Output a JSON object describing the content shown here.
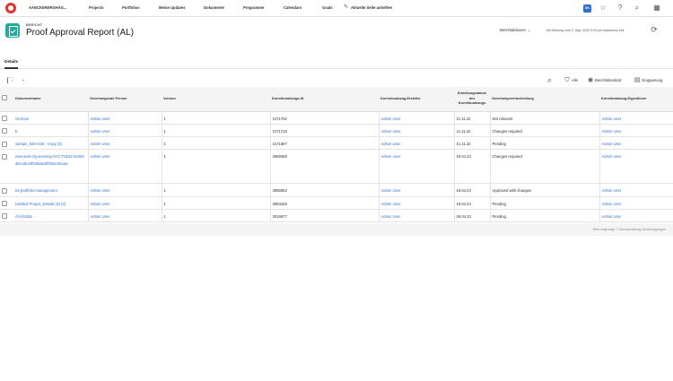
{
  "nav": {
    "org": "AANCKERERSHÄG...",
    "items": [
      "Projects",
      "Portfolios",
      "Meine Updates",
      "Dokumente",
      "Programme",
      "Calendars",
      "Goals"
    ],
    "pin_label": "Aktuelle Seite anheften",
    "avatar_initials": "SK"
  },
  "header": {
    "kind": "BERICHT",
    "title": "Proof Approval Report (AL)",
    "actions_label": "Berichtaktionen",
    "last_updated": "Mit Wirkung vom 3. Sep. 2023 3:03 pm indischma-Zeit"
  },
  "tabs": [
    "Details"
  ],
  "toolbar": {
    "select_label": "↓",
    "filter_label": "Alle",
    "view_label": "Berichtstandard",
    "group_label": "Gruppierung"
  },
  "table": {
    "headers": [
      "Dokumentname",
      "Genehmigende Person",
      "Version",
      "Korrekturabzugs-ID",
      "Korrekturabzug-Ersteller",
      "Erstellungsdatum des Korrekturabzugs",
      "Genehmigerentscheidung",
      "Korrekturabzug-Eigentümer"
    ],
    "rows": [
      [
        "German",
        "Admin User",
        "1",
        "2171702",
        "Admin User",
        "21.11.22",
        "Not relevant",
        "Admin User"
      ],
      [
        "b",
        "Admin User",
        "1",
        "2171718",
        "Admin User",
        "21.11.22",
        "Changes required",
        "Admin User"
      ],
      [
        "sample_640×426 - Copy (2)",
        "Admin User",
        "1",
        "2171687",
        "Admin User",
        "21.11.22",
        "Pending",
        "Admin User"
      ],
      [
        "new-york-city-evening-NYCTG622-52492d6ccab44f528a5c8ff40ac02aea",
        "Admin User",
        "1",
        "3086059",
        "Admin User",
        "19.04.23",
        "Changes required",
        "Admin User"
      ],
      [
        "02-portfolio-management",
        "Admin User",
        "1",
        "3086054",
        "Admin User",
        "19.04.23",
        "Approved with changes",
        "Admin User"
      ],
      [
        "Untitled Project_Details (3) (3)",
        "Admin User",
        "1",
        "3084228",
        "Admin User",
        "19.04.23",
        "Pending",
        "Admin User"
      ],
      [
        "ÄÄÜÜöüä",
        "Admin User",
        "1",
        "3016677",
        "Admin User",
        "06.04.23",
        "Pending",
        "Admin User"
      ]
    ]
  },
  "footer": {
    "summary": "Wird angezeigt: 7 Korrekturabzug-Genehmigungen"
  },
  "colors": {
    "brand_red": "#e4322b",
    "report_teal": "#21a99a",
    "link_blue": "#2f6fd1"
  }
}
